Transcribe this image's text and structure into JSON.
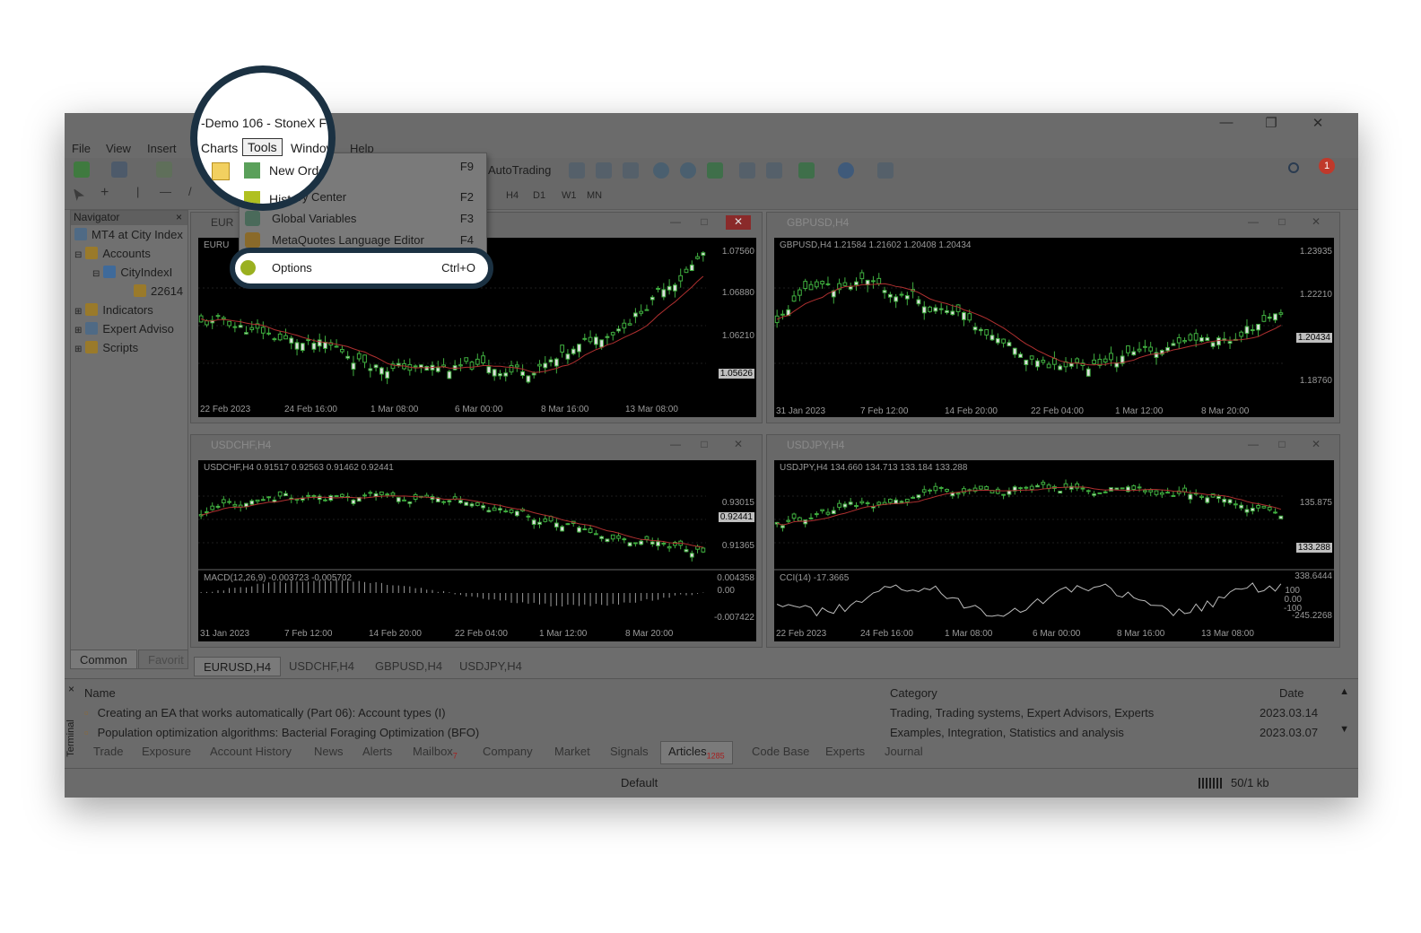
{
  "window": {
    "title": "-Demo 106 - StoneX F",
    "controls": {
      "minimize": "—",
      "restore": "❐",
      "close": "✕"
    }
  },
  "menu": {
    "items": [
      "File",
      "View",
      "Insert",
      "Charts",
      "Tools",
      "Window",
      "Help"
    ],
    "active": "Tools"
  },
  "toolbar": {
    "autotrading_label": "AutoTrading",
    "timeframes": [
      "H4",
      "D1",
      "W1",
      "MN"
    ],
    "notification_count": "1"
  },
  "tools_menu": {
    "items": [
      {
        "label": "New Order",
        "key": "F9",
        "icon": "new-order-icon"
      },
      {
        "label": "History Center",
        "key": "F2",
        "icon": "history-center-icon"
      },
      {
        "label": "Global Variables",
        "key": "F3",
        "icon": "global-variables-icon"
      },
      {
        "label": "MetaQuotes Language Editor",
        "key": "F4",
        "icon": "metaeditor-icon"
      }
    ],
    "highlighted": {
      "label": "Options",
      "key": "Ctrl+O",
      "icon": "options-icon"
    }
  },
  "navigator": {
    "title": "Navigator",
    "items": [
      {
        "label": "MT4 at City Index",
        "level": 0,
        "icon": "platform-icon"
      },
      {
        "label": "Accounts",
        "level": 1,
        "icon": "accounts-icon"
      },
      {
        "label": "CityIndexI",
        "level": 2,
        "icon": "server-icon"
      },
      {
        "label": "22614",
        "level": 3,
        "icon": "account-icon"
      },
      {
        "label": "Indicators",
        "level": 1,
        "icon": "indicators-icon"
      },
      {
        "label": "Expert Adviso",
        "level": 1,
        "icon": "expert-advisors-icon"
      },
      {
        "label": "Scripts",
        "level": 1,
        "icon": "scripts-icon"
      }
    ],
    "tabs": [
      "Common",
      "Favorit"
    ]
  },
  "charts": [
    {
      "window_title": "EUR",
      "ohlc": "EURU",
      "prices": [
        "1.07560",
        "1.06880",
        "1.06210"
      ],
      "current_price": "1.05626",
      "times": [
        "22 Feb 2023",
        "24 Feb 16:00",
        "1 Mar 08:00",
        "6 Mar 00:00",
        "8 Mar 16:00",
        "13 Mar 08:00"
      ]
    },
    {
      "window_title": "GBPUSD,H4",
      "ohlc": "GBPUSD,H4  1.21584 1.21602 1.20408 1.20434",
      "prices": [
        "1.23935",
        "1.22210",
        "1.18760"
      ],
      "current_price": "1.20434",
      "times": [
        "31 Jan 2023",
        "7 Feb 12:00",
        "14 Feb 20:00",
        "22 Feb 04:00",
        "1 Mar 12:00",
        "8 Mar 20:00"
      ]
    },
    {
      "window_title": "USDCHF,H4",
      "ohlc": "USDCHF,H4  0.91517 0.92563 0.91462 0.92441",
      "prices": [
        "0.93015",
        "0.91365"
      ],
      "current_price": "0.92441",
      "indicator": "MACD(12,26,9) -0.003723 -0.005702",
      "indicator_scale": [
        "0.004358",
        "0.00",
        "-0.007422"
      ],
      "times": [
        "31 Jan 2023",
        "7 Feb 12:00",
        "14 Feb 20:00",
        "22 Feb 04:00",
        "1 Mar 12:00",
        "8 Mar 20:00"
      ]
    },
    {
      "window_title": "USDJPY,H4",
      "ohlc": "USDJPY,H4  134.660 134.713 133.184 133.288",
      "prices": [
        "135.875"
      ],
      "current_price": "133.288",
      "indicator": "CCI(14) -17.3665",
      "indicator_scale": [
        "338.6444",
        "100",
        "0.00",
        "-100",
        "-245.2268"
      ],
      "times": [
        "22 Feb 2023",
        "24 Feb 16:00",
        "1 Mar 08:00",
        "6 Mar 00:00",
        "8 Mar 16:00",
        "13 Mar 08:00"
      ]
    }
  ],
  "chart_tabs": [
    "EURUSD,H4",
    "USDCHF,H4",
    "GBPUSD,H4",
    "USDJPY,H4"
  ],
  "terminal": {
    "side_label": "Terminal",
    "columns": [
      "Name",
      "Category",
      "Date"
    ],
    "rows": [
      {
        "name": "Creating an EA that works automatically (Part 06): Account types (I)",
        "category": "Trading, Trading systems, Expert Advisors, Experts",
        "date": "2023.03.14"
      },
      {
        "name": "Population optimization algorithms: Bacterial Foraging Optimization (BFO)",
        "category": "Examples, Integration, Statistics and analysis",
        "date": "2023.03.07"
      }
    ],
    "tabs": [
      "Trade",
      "Exposure",
      "Account History",
      "News",
      "Alerts",
      "Mailbox",
      "Company",
      "Market",
      "Signals",
      "Articles",
      "Code Base",
      "Experts",
      "Journal"
    ],
    "mailbox_badge": "7",
    "articles_badge": "1285",
    "active_tab": "Articles"
  },
  "status": {
    "profile": "Default",
    "traffic": "50/1 kb"
  },
  "colors": {
    "highlight_ring": "#1b3142",
    "candle_green": "#3fae3f",
    "ma_red": "#b03030"
  }
}
